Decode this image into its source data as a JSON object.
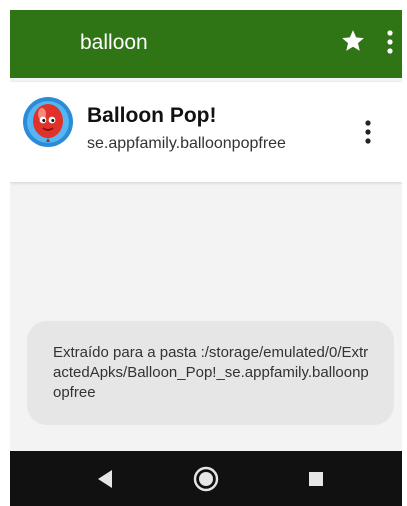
{
  "toolbar": {
    "search_query": "balloon",
    "star_icon": "star-icon",
    "menu_icon": "more-vert-icon"
  },
  "app_item": {
    "name": "Balloon Pop!",
    "package": "se.appfamily.balloonpopfree",
    "icon": "balloon-app-icon",
    "menu_icon": "more-vert-icon"
  },
  "toast": {
    "message": "Extraído para a pasta :/storage/emulated/0/ExtractedApks/Balloon_Pop!_se.appfamily.balloonpopfree"
  },
  "nav": {
    "back": "back-icon",
    "home": "home-icon",
    "recents": "recents-icon"
  },
  "colors": {
    "primary": "#2f7515",
    "background": "#f3f3f3",
    "toast": "#e6e6e6",
    "navbar": "#111111"
  }
}
